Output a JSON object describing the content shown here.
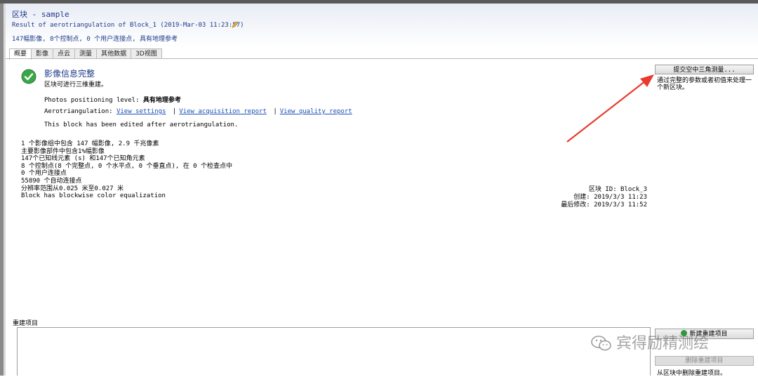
{
  "header": {
    "title": "区块 - sample",
    "result": "Result of aerotriangulation of Block_1 (2019-Mar-03 11:23:57)",
    "summary": "147幅影像, 8个控制点, 0 个用户连接点, 具有地理参考"
  },
  "tabs": [
    "概要",
    "影像",
    "点云",
    "测量",
    "其他数据",
    "3D视图"
  ],
  "status": {
    "title": "影像信息完整",
    "subtitle": "区块可进行三维重建。"
  },
  "positioning": {
    "label": "Photos positioning level:",
    "value": "具有地理参考"
  },
  "aerotriangulation": {
    "label": "Aerotriangulation:",
    "view_settings": "View settings",
    "view_acquisition": "View acquisition report",
    "view_quality": "View quality report",
    "separator": "|"
  },
  "edited_note": "This block has been edited after aerotriangulation.",
  "info": [
    "1 个影像组中包含 147 幅影像, 2.9 千兆像素",
    "主要影像部件中包含1%幅影像",
    "147个已知线元素 (s) 和147个已知角元素",
    "8 个控制点(8 个完整点, 0 个水平点, 0 个垂直点), 在 0 个检查点中",
    "0 个用户连接点",
    "55890 个自动连接点",
    "分辨率范围从0.025 米至0.027 米",
    "Block has blockwise color equalization"
  ],
  "meta": {
    "block_id": "区块 ID: Block_3",
    "created": "创建: 2019/3/3 11:23",
    "modified": "最后修改: 2019/3/3 11:52"
  },
  "actions": {
    "submit_at": "提交空中三角测量...",
    "submit_desc": "通过完整的参数或者初值来处理一个新区块。",
    "new_recon": "新建重建项目",
    "delete_recon": "删除重建项目",
    "delete_desc": "从区块中删除重建项目。"
  },
  "reconstruction": {
    "label": "重建项目"
  },
  "watermark": "宾得励精测绘",
  "colors": {
    "title_blue": "#1f3a8a",
    "link_blue": "#1a4fb8",
    "ok_green": "#2e9a3c",
    "arrow_red": "#e83a2e"
  }
}
